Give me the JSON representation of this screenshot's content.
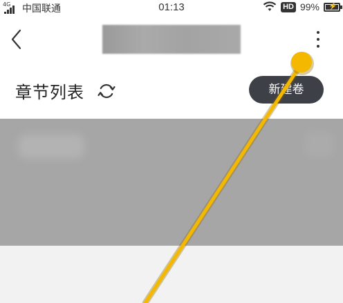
{
  "status_bar": {
    "network": "4G",
    "carrier": "中国联通",
    "time": "01:13",
    "hd_label": "HD",
    "battery_percent": "99%",
    "battery_level": 0.99,
    "icons": [
      "signal-icon",
      "wifi-icon",
      "battery-icon"
    ]
  },
  "nav": {
    "back_icon": "chevron-left-icon",
    "title": "",
    "more_icon": "more-vertical-icon"
  },
  "chapter_section": {
    "title": "章节列表",
    "refresh_icon": "refresh-icon",
    "new_volume_label": "新建卷",
    "accent_color": "#3d4047"
  },
  "gesture": {
    "color": "#f5b800",
    "description_icon": "tap-drag-gesture"
  }
}
